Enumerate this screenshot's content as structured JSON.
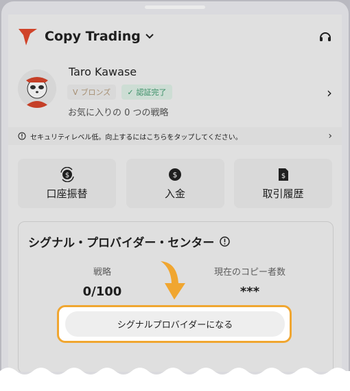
{
  "header": {
    "title": "Copy Trading"
  },
  "profile": {
    "name": "Taro Kawase",
    "badge_bronze": "ブロンズ",
    "badge_verified": "認証完了",
    "favorites_text": "お気に入りの 0 つの戦略"
  },
  "security_banner": {
    "text": "セキュリティレベル低。向上するにはこちらをタップしてください。"
  },
  "actions": [
    {
      "label": "口座振替",
      "icon": "transfer-icon"
    },
    {
      "label": "入金",
      "icon": "deposit-icon"
    },
    {
      "label": "取引履歴",
      "icon": "history-icon"
    }
  ],
  "signal_center": {
    "title": "シグナル・プロバイダー・センター",
    "stats": [
      {
        "label": "戦略",
        "value": "0/100"
      },
      {
        "label": "現在のコピー者数",
        "value": "***"
      }
    ],
    "cta_label": "シグナルプロバイダーになる"
  },
  "colors": {
    "accent": "#f0a630",
    "brand_red": "#e2492d",
    "verified_green": "#3a9a6c"
  }
}
